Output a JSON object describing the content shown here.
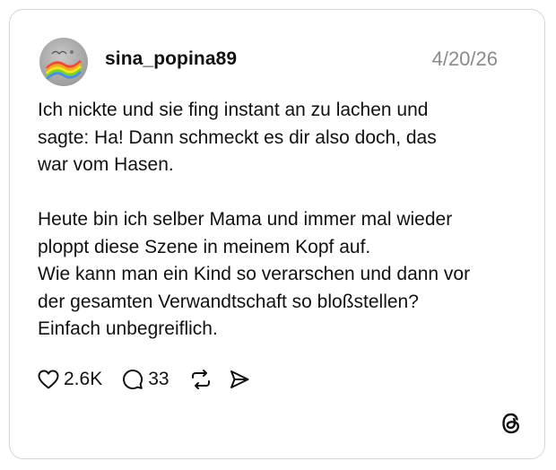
{
  "post": {
    "username": "sina_popina89",
    "date": "4/20/26",
    "paragraphs": [
      [
        "Ich nickte und sie fing instant an zu lachen und",
        "sagte: Ha! Dann schmeckt es dir also doch, das",
        "war vom Hasen."
      ],
      [
        "Heute bin ich selber Mama und immer mal wieder",
        "ploppt diese Szene in meinem Kopf auf.",
        "Wie kann man ein Kind so verarschen und dann vor",
        "der gesamten Verwandtschaft so bloßstellen?",
        "Einfach unbegreiflich."
      ]
    ]
  },
  "actions": {
    "likes": "2.6K",
    "replies": "33"
  },
  "icons": {
    "like": "heart-icon",
    "reply": "speech-bubble-icon",
    "repost": "repost-icon",
    "share": "send-icon",
    "logo": "threads-logo-icon",
    "avatar": "profile-avatar"
  }
}
